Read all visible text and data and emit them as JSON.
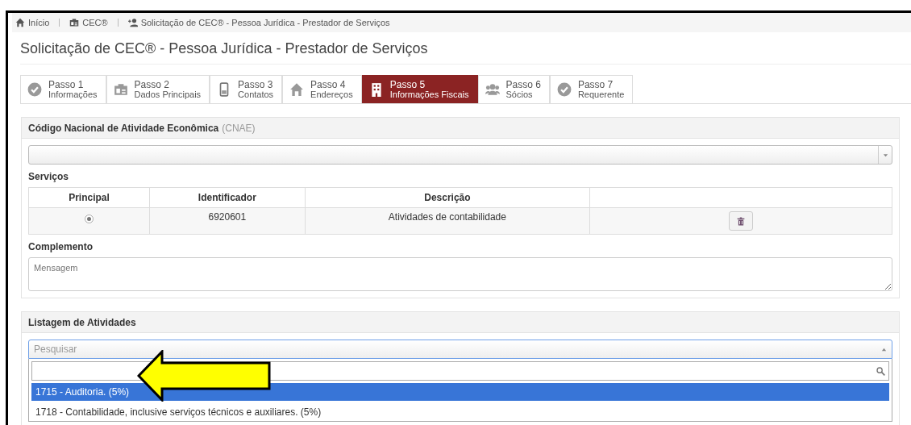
{
  "breadcrumb": [
    {
      "label": "Início"
    },
    {
      "label": "CEC®"
    },
    {
      "label": "Solicitação de CEC® - Pessoa Jurídica - Prestador de Serviços"
    }
  ],
  "page_title": "Solicitação de CEC® - Pessoa Jurídica - Prestador de Serviços",
  "tabs": [
    {
      "step": "Passo 1",
      "label": "Informações",
      "selected": false
    },
    {
      "step": "Passo 2",
      "label": "Dados Principais",
      "selected": false
    },
    {
      "step": "Passo 3",
      "label": "Contatos",
      "selected": false
    },
    {
      "step": "Passo 4",
      "label": "Endereços",
      "selected": false
    },
    {
      "step": "Passo 5",
      "label": "Informações Fiscais",
      "selected": true
    },
    {
      "step": "Passo 6",
      "label": "Sócios",
      "selected": false
    },
    {
      "step": "Passo 7",
      "label": "Requerente",
      "selected": false
    }
  ],
  "cnae_panel": {
    "title": "Código Nacional de Atividade Econômica",
    "title_note": "(CNAE)",
    "services_label": "Serviços",
    "table": {
      "columns": [
        "Principal",
        "Identificador",
        "Descrição"
      ],
      "rows": [
        {
          "principal_selected": true,
          "identificador": "6920601",
          "descricao": "Atividades de contabilidade"
        }
      ]
    },
    "complemento_label": "Complemento",
    "complemento_placeholder": "Mensagem"
  },
  "activities_panel": {
    "title": "Listagem de Atividades",
    "select_placeholder": "Pesquisar",
    "options": [
      {
        "label": "1715 - Auditoria. (5%)",
        "selected": true
      },
      {
        "label": "1718 - Contabilidade, inclusive serviços técnicos e auxiliares. (5%)",
        "selected": false
      }
    ]
  }
}
